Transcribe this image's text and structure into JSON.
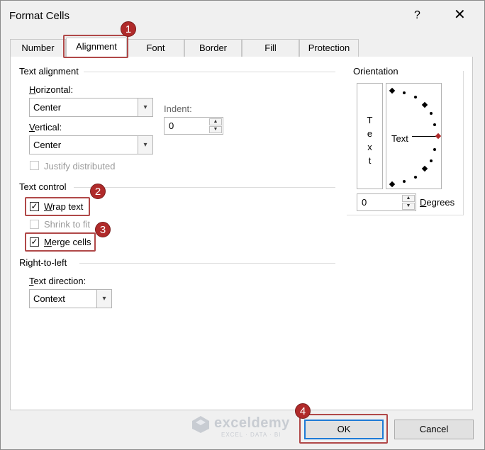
{
  "window": {
    "title": "Format Cells",
    "help_glyph": "?",
    "close_glyph": "✕"
  },
  "tabs": [
    {
      "label": "Number"
    },
    {
      "label": "Alignment"
    },
    {
      "label": "Font"
    },
    {
      "label": "Border"
    },
    {
      "label": "Fill"
    },
    {
      "label": "Protection"
    }
  ],
  "text_alignment": {
    "group_title": "Text alignment",
    "horizontal_label_ul": "H",
    "horizontal_label_rest": "orizontal:",
    "horizontal_value": "Center",
    "vertical_label_ul": "V",
    "vertical_label_rest": "ertical:",
    "vertical_value": "Center",
    "indent_label": "Indent:",
    "indent_value": "0",
    "justify_label": "Justify distributed"
  },
  "text_control": {
    "group_title": "Text control",
    "wrap_ul": "W",
    "wrap_rest": "rap text",
    "shrink_label": "Shrink to fit",
    "merge_ul": "M",
    "merge_rest": "erge cells"
  },
  "rtl": {
    "group_title": "Right-to-left",
    "direction_label_ul": "T",
    "direction_label_rest": "ext direction:",
    "direction_value": "Context"
  },
  "orientation": {
    "group_title": "Orientation",
    "vertical_text": [
      "T",
      "e",
      "x",
      "t"
    ],
    "dial_text": "Text",
    "degrees_value": "0",
    "degrees_label_ul": "D",
    "degrees_label_rest": "egrees"
  },
  "checkbox_glyph": "✓",
  "arrow_glyph": "▾",
  "spin_up_glyph": "▲",
  "spin_down_glyph": "▼",
  "badges": {
    "b1": "1",
    "b2": "2",
    "b3": "3",
    "b4": "4"
  },
  "accent_red": "#b04848",
  "accent_blue": "#1f7bd6",
  "watermark": {
    "name": "exceldemy",
    "tagline": "EXCEL · DATA · BI"
  },
  "buttons": {
    "ok": "OK",
    "cancel": "Cancel"
  }
}
